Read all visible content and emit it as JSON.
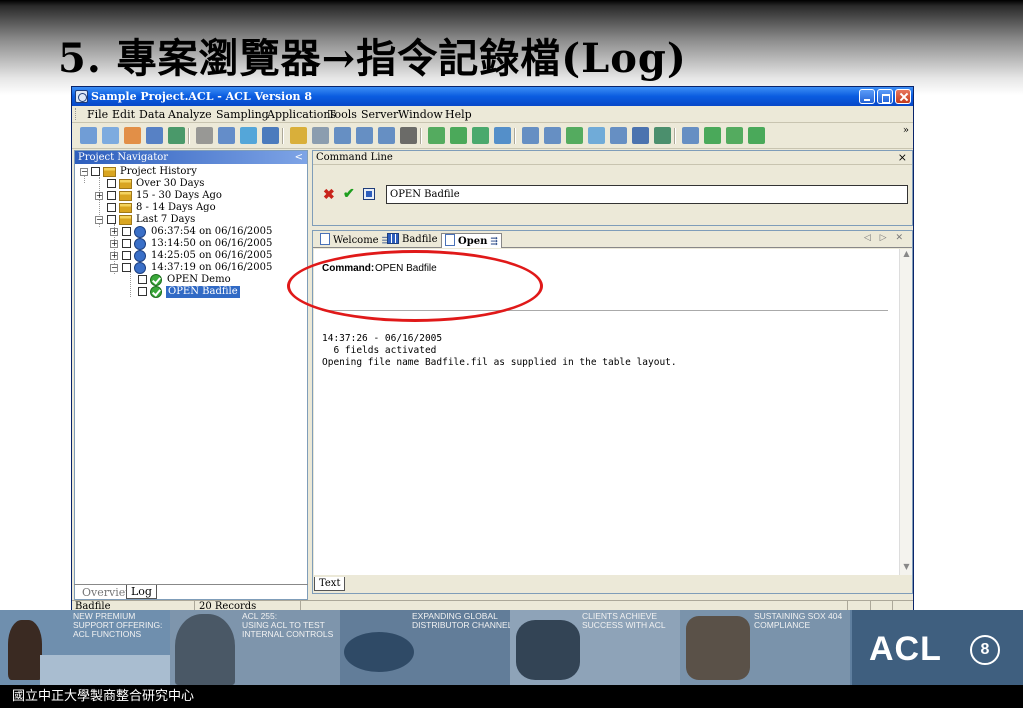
{
  "slide": {
    "title": "5.  專案瀏覽器→指令記錄檔(Log)",
    "footer": "國立中正大學製商整合研究中心"
  },
  "window": {
    "title": "Sample Project.ACL - ACL Version 8"
  },
  "menu": [
    "File",
    "Edit",
    "Data",
    "Analyze",
    "Sampling",
    "Applications",
    "Tools",
    "Server",
    "Window",
    "Help"
  ],
  "toolbar": {
    "overflow": "»",
    "icons": [
      "open-project-icon",
      "open-table-icon",
      "copy-table-icon",
      "save-icon",
      "import-icon",
      "print-preview-icon",
      "refresh-icon",
      "view-icon",
      "back-icon",
      "paste-icon",
      "edit-table-icon",
      "table-layout-icon",
      "edit-view-icon",
      "modify-view-icon",
      "print-icon",
      "filter-icon",
      "chart-icon",
      "statistics-icon",
      "percent-icon",
      "tree-icon",
      "columns-icon",
      "join-icon",
      "numbers-icon",
      "text-icon",
      "digits-icon",
      "histogram-icon",
      "script-icon",
      "run-icon",
      "add-column-icon",
      "grid-icon"
    ]
  },
  "navigator": {
    "header": "Project Navigator",
    "collapse": "<",
    "tree": {
      "root": "Project History",
      "over30": "Over 30 Days",
      "d15_30": "15 - 30 Days Ago",
      "d8_14": "8 - 14 Days Ago",
      "last7": "Last 7 Days",
      "s1": "06:37:54 on 06/16/2005",
      "s2": "13:14:50 on 06/16/2005",
      "s3": "14:25:05 on 06/16/2005",
      "s4": "14:37:19 on 06/16/2005",
      "cmd1": "OPEN Demo",
      "cmd2": "OPEN Badfile"
    },
    "tabs": {
      "overview": "Overview",
      "log": "Log"
    }
  },
  "command_line": {
    "header": "Command Line",
    "close": "×",
    "value": "OPEN Badfile"
  },
  "results": {
    "tabs": {
      "welcome": "Welcome",
      "badfile": "Badfile",
      "open": "Open"
    },
    "tab_nav": "◁ ▷ ✕",
    "command_label": "Command:",
    "command_text": "OPEN Badfile",
    "log_lines": [
      "14:37:26 - 06/16/2005",
      "  6 fields activated",
      "Opening file name Badfile.fil as supplied in the table layout."
    ],
    "text_tab": "Text"
  },
  "status": {
    "table": "Badfile",
    "records": "20 Records"
  },
  "banner": {
    "panels": [
      "NEW PREMIUM\nSUPPORT OFFERING:\nACL FUNCTIONS",
      "ACL 255:\nUSING ACL TO TEST\nINTERNAL CONTROLS",
      "EXPANDING GLOBAL\nDISTRIBUTOR CHANNELS",
      "CLIENTS ACHIEVE\nSUCCESS WITH ACL",
      "SUSTAINING SOX 404\nCOMPLIANCE"
    ],
    "logo": "ACL",
    "version": "8"
  }
}
